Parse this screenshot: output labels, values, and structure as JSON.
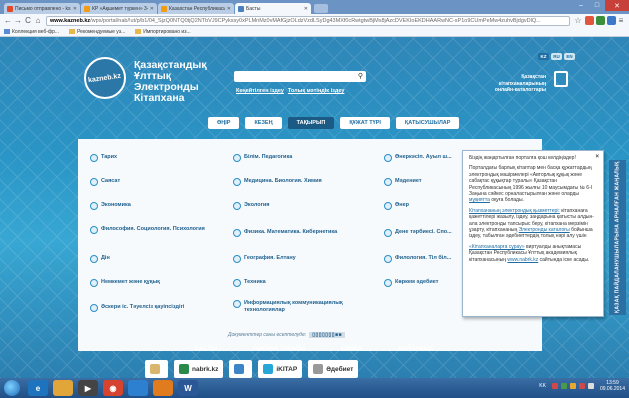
{
  "browser": {
    "tabs": [
      {
        "label": "Письмо отправлено - ks...",
        "fav": "mail-icon",
        "active": false
      },
      {
        "label": "КР «Ақшемет түркен» 3-...",
        "fav": "page-icon",
        "active": false
      },
      {
        "label": "Казахстан Республикасы...",
        "fav": "page-icon",
        "active": false
      },
      {
        "label": "Басты",
        "fav": "page-icon",
        "active": true
      }
    ],
    "url_domain": "www.kazneb.kz",
    "url_path": "/wps/portal/nab/!ut/p/b1/04_SjzQ0NTQ0tjQ2NTbVJ9CPykssy0xPLMnMz0vMAfGjzOLdzVzdLSyDg43MXf0cRwtgtwBjMx8jAzcDVEKIoEKDHAARwNC-sP1o9CUmPeMw4zuhvBjdgvDlQ...",
    "bookmarks": [
      "Коллекция веб-фр...",
      "Рекомендуемые уз...",
      "Импортировано из..."
    ]
  },
  "site": {
    "logo_text": "kazneb.kz",
    "name_lines": [
      "Қазақстандық",
      "Ұлттық",
      "Электронды",
      "Кітапхана"
    ],
    "search_placeholder": "",
    "search_links": [
      "Кеңейтілген іздеу",
      "Толық мәтіндік іздеу"
    ],
    "languages": [
      "KZ",
      "RU",
      "EN"
    ],
    "catalogs_text": "Қазақстан кітапханаларының онлайн-каталогтары",
    "nav": [
      "ӨҢІР",
      "КЕЗЕҢ",
      "ТАҚЫРЫП",
      "ҚҰЖАТ ТҮРІ",
      "ҚАТЫСУШЫЛАР"
    ],
    "nav_active": "ТАҚЫРЫП",
    "topics": {
      "col1": [
        "Тарих",
        "Саясат",
        "Экономика",
        "Философия. Социология. Психология",
        "Дін",
        "Немкемет және құқық",
        "Әскери іс. Тәуелсіз қауіпсіздігі"
      ],
      "col2": [
        "Білім. Педагогика",
        "Медицина. Биология. Химия",
        "Экология",
        "Физика. Математика. Кибернетика",
        "География. Елтану",
        "Техника",
        "Информациялық коммуникациялық технологиялар"
      ],
      "col3": [
        "Өнеркәсіп. Ауыл ш...",
        "Мәдениет",
        "Өнер",
        "Дене тәрбиесі. Спо...",
        "Филология. Тіл біл...",
        "Көркем әдебиет"
      ]
    },
    "doc_count_label": "Документтер саны есептелуде:",
    "doc_count_value": "▯▯▯▯▯▯▯■■",
    "popup": {
      "close": "×",
      "p1": "Біздің жаңартылған порталға қош келдіңіздер!",
      "p2": "Порталдағы барлық кітаптар мен басқа құжаттардың электрондық көшірмелері «Авторлық құқық және сабақтас құқықтар туралы» Қазақстан Республикасының 1996 жылғы 10 маусымдағы № 6-І Заңына сәйкес орналастырылған және оларды",
      "p2_link": "мұқиятта",
      "p2_tail": "оқуға болады.",
      "p3_link1": "Кітапхананың электрондық қызметтері:",
      "p3": "кітапханаға қажеттілері жазылу, іздеу, заңдарына қатысты алдын-ала электронды тапсырыс беру, кітапхана мерзімін ұзарту, кітапхананың",
      "p3_link2": "Электронды каталоғы",
      "p3_tail": "бойынша іздеу, табылған әдебиеттердің толық нәрі алу үшін",
      "p4_link": "«Кітапханаларға сұрау»",
      "p4": "виртуалды анықтамасы Қазақстан Республикасы Ұлттық академиялық кітапханасының",
      "p4_link2": "www.nabrk.kz",
      "p4_tail": "сайтында іске асады."
    },
    "side_tab": "ҚАЗАҚ ПАЙДАЛАНУШЫЛАРЫНА АРНАЛҒАН ЖАҢАЛЫҚ",
    "footer_links": [
      "БАСТЫ",
      "ПОРТАЛ ТУРАЛЫ",
      "КӨМЕК",
      "БАЙЛАНЫС"
    ],
    "partners": [
      "",
      "nabrk.kz",
      "",
      "iKITAP",
      "Әдебиет"
    ]
  },
  "taskbar": {
    "lang": "KK",
    "time": "13:59",
    "date": "09.06.2014"
  },
  "colors": {
    "accent": "#2a95c6",
    "nav_active": "#1c5a86"
  }
}
